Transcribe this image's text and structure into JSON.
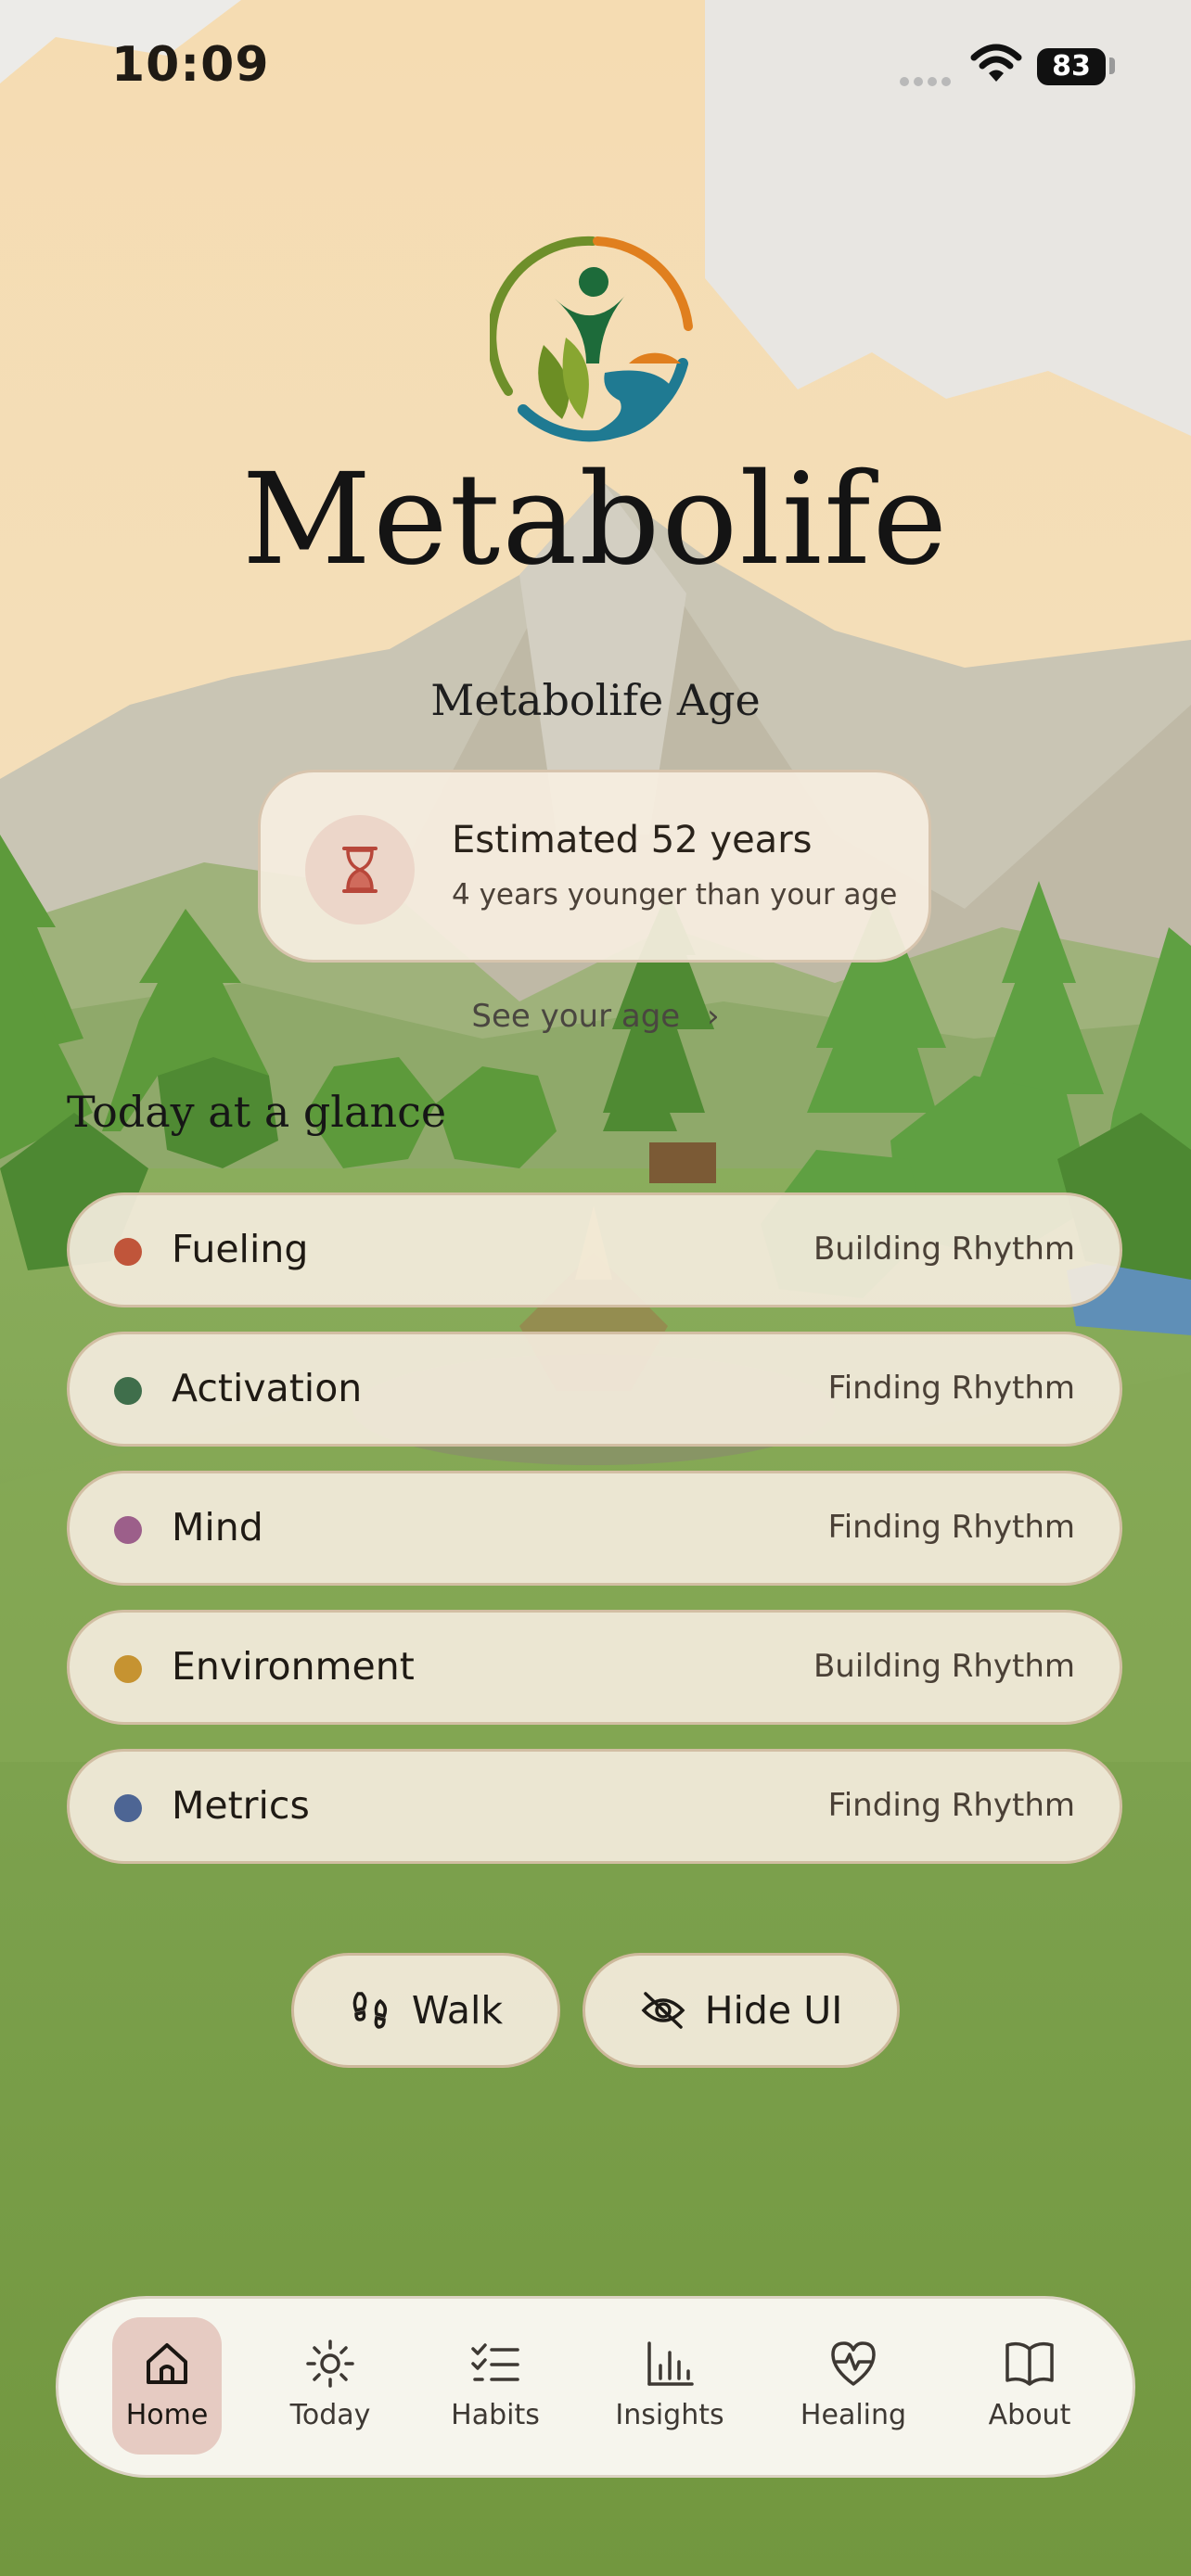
{
  "status_bar": {
    "time": "10:09",
    "battery": "83"
  },
  "brand": {
    "name": "Metabolife"
  },
  "age_section": {
    "title": "Metabolife Age",
    "estimate": "Estimated 52 years",
    "comparison": "4 years younger than your age",
    "link_label": "See your age",
    "link_chevron": "›"
  },
  "glance": {
    "title": "Today at a glance",
    "items": [
      {
        "label": "Fueling",
        "status": "Building Rhythm",
        "color": "#c0553a"
      },
      {
        "label": "Activation",
        "status": "Finding Rhythm",
        "color": "#3f6e4b"
      },
      {
        "label": "Mind",
        "status": "Finding Rhythm",
        "color": "#9c5f8a"
      },
      {
        "label": "Environment",
        "status": "Building Rhythm",
        "color": "#c69331"
      },
      {
        "label": "Metrics",
        "status": "Finding Rhythm",
        "color": "#4d6594"
      }
    ]
  },
  "actions": {
    "walk_label": "Walk",
    "hide_ui_label": "Hide UI"
  },
  "tabs": [
    {
      "label": "Home",
      "icon": "home-icon",
      "active": true
    },
    {
      "label": "Today",
      "icon": "sun-icon",
      "active": false
    },
    {
      "label": "Habits",
      "icon": "checklist-icon",
      "active": false
    },
    {
      "label": "Insights",
      "icon": "bar-chart-icon",
      "active": false
    },
    {
      "label": "Healing",
      "icon": "heart-pulse-icon",
      "active": false
    },
    {
      "label": "About",
      "icon": "book-icon",
      "active": false
    }
  ]
}
